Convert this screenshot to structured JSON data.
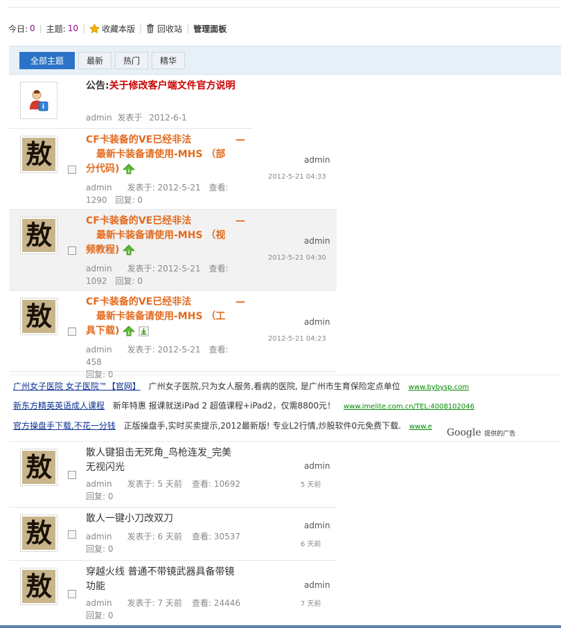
{
  "stats": {
    "today_label": "今日:",
    "today_value": "0",
    "topics_label": "主题:",
    "topics_value": "10",
    "favorite_label": "收藏本版",
    "recycle_label": "回收站",
    "admin_panel_label": "管理面板"
  },
  "tabs": [
    {
      "label": "全部主题"
    },
    {
      "label": "最新"
    },
    {
      "label": "热门"
    },
    {
      "label": "精华"
    }
  ],
  "notice": {
    "prefix": "公告:",
    "title": "关于修改客户端文件官方说明",
    "author": "admin",
    "posted": "发表于",
    "date": "2012-6-1"
  },
  "threads": [
    {
      "title_line1": "CF卡装备的VE已经非法",
      "title_dash": "—",
      "title_line2": "最新卡装备请使用-MHS （部",
      "title_line3": "分代码)",
      "author": "admin",
      "posted_label": "发表于:",
      "posted": "2012-5-21",
      "views_label": "查看:",
      "views": "1290",
      "replies_label": "回复:",
      "replies": "0",
      "last_author": "admin",
      "last_time": "2012-5-21 04:33"
    },
    {
      "title_line1": "CF卡装备的VE已经非法",
      "title_dash": "—",
      "title_line2": "最新卡装备请使用-MHS （视",
      "title_line3": "频教程)",
      "author": "admin",
      "posted_label": "发表于:",
      "posted": "2012-5-21",
      "views_label": "查看:",
      "views": "1092",
      "replies_label": "回复:",
      "replies": "0",
      "last_author": "admin",
      "last_time": "2012-5-21 04:30"
    },
    {
      "title_line1": "CF卡装备的VE已经非法",
      "title_dash": "—",
      "title_line2": "最新卡装备请使用-MHS （工",
      "title_line3": "具下载)",
      "author": "admin",
      "posted_label": "发表于:",
      "posted": "2012-5-21",
      "views_label": "查看:",
      "views": "458",
      "replies_label": "回复:",
      "replies": "0",
      "last_author": "admin",
      "last_time": "2012-5-21 04:23"
    }
  ],
  "ads": [
    {
      "link": "广州女子医院 女子医院™【官网】",
      "text": "广州女子医院,只为女人服务,看病的医院, 是广州市生育保险定点单位",
      "url": "www.bybysp.com"
    },
    {
      "link": "新东方精英英语成人课程",
      "text": "新年特惠  报课就送iPad 2 超值课程+iPad2，仅需8800元！",
      "url": "www.imelite.com.cn/TEL:4008102046"
    },
    {
      "link": "官方操盘手下载,不花一分钱",
      "text": "正版操盘手,实时买卖提示,2012最新版! 专业L2行情,炒股软件0元免费下载.",
      "url": "www.e"
    }
  ],
  "google": {
    "brand": "Google",
    "suffix": "提供的广告"
  },
  "normal_threads": [
    {
      "title_line1": "散人键狙击无死角_鸟枪连发_完美",
      "title_line2": "无视闪光",
      "author": "admin",
      "posted_label": "发表于:",
      "posted": "5 天前",
      "views_label": "查看:",
      "views": "10692",
      "replies_label": "回复:",
      "replies": "0",
      "last_author": "admin",
      "last_time": "5 天前"
    },
    {
      "title_line1": "散人一键小刀改双刀",
      "title_line2": "",
      "author": "admin",
      "posted_label": "发表于:",
      "posted": "6 天前",
      "views_label": "查看:",
      "views": "30537",
      "replies_label": "回复:",
      "replies": "0",
      "last_author": "admin",
      "last_time": "6 天前"
    },
    {
      "title_line1": "穿越火线 普通不带镜武器具备带镜",
      "title_line2": "功能",
      "author": "admin",
      "posted_label": "发表于:",
      "posted": "7 天前",
      "views_label": "查看:",
      "views": "24446",
      "replies_label": "回复:",
      "replies": "0",
      "last_author": "admin",
      "last_time": "7 天前"
    }
  ],
  "avatar_glyph": "敖",
  "colors": {
    "accent": "#2b73c7",
    "title_orange": "#e26b1f",
    "notice_red": "#cc0000",
    "count_purple": "#8a0a8a",
    "ad_link": "#0b2f91",
    "ad_url": "#008a00"
  }
}
